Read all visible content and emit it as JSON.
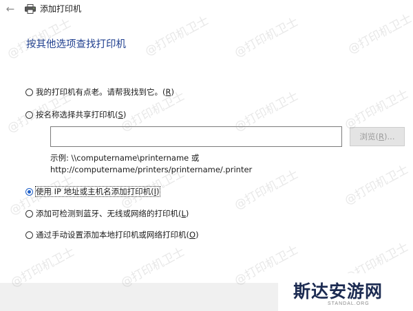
{
  "window": {
    "title": "添加打印机",
    "back_icon": "back-arrow-icon",
    "app_icon": "printer-icon"
  },
  "heading": "按其他选项查找打印机",
  "options": [
    {
      "label": "我的打印机有点老。请帮我找到它。",
      "accel": "R",
      "selected": false
    },
    {
      "label": "按名称选择共享打印机",
      "accel": "S",
      "selected": false
    },
    {
      "label": "使用 IP 地址或主机名添加打印机",
      "accel": "I",
      "selected": true
    },
    {
      "label": "添加可检测到蓝牙、无线或网络的打印机",
      "accel": "L",
      "selected": false
    },
    {
      "label": "通过手动设置添加本地打印机或网络打印机",
      "accel": "O",
      "selected": false
    }
  ],
  "shared_printer": {
    "input_value": "",
    "browse_label": "浏览(",
    "browse_accel": "R",
    "browse_suffix": ")...",
    "example_line1": "示例: \\\\computername\\printername 或",
    "example_line2": "http://computername/printers/printername/.printer"
  },
  "watermark_text": "@打印机卫士",
  "logo": {
    "text": "斯达安游网",
    "sub": "STANDAL.ORG"
  },
  "colors": {
    "heading": "#1f3f8f",
    "radio_selected": "#1d5fc9",
    "footer_bg": "#f0f0f0",
    "button_disabled_bg": "#e4e4e4",
    "button_disabled_text": "#9b9b9b"
  }
}
